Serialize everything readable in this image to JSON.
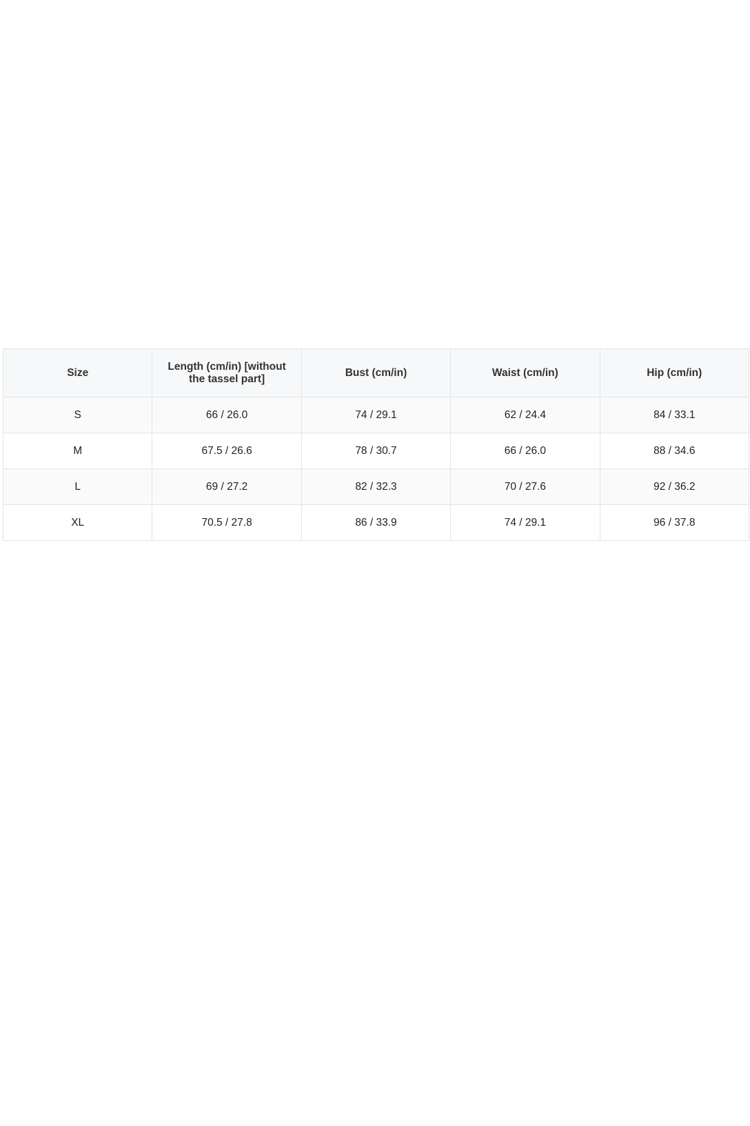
{
  "size_chart": {
    "headers": [
      "Size",
      "Length (cm/in) [without the tassel part]",
      "Bust (cm/in)",
      "Waist (cm/in)",
      "Hip (cm/in)"
    ],
    "rows": [
      [
        "S",
        "66 / 26.0",
        "74 / 29.1",
        "62 / 24.4",
        "84 / 33.1"
      ],
      [
        "M",
        "67.5 / 26.6",
        "78 / 30.7",
        "66 / 26.0",
        "88 / 34.6"
      ],
      [
        "L",
        "69 / 27.2",
        "82 / 32.3",
        "70 / 27.6",
        "92 / 36.2"
      ],
      [
        "XL",
        "70.5 / 27.8",
        "86 / 33.9",
        "74 / 29.1",
        "96 / 37.8"
      ]
    ]
  }
}
